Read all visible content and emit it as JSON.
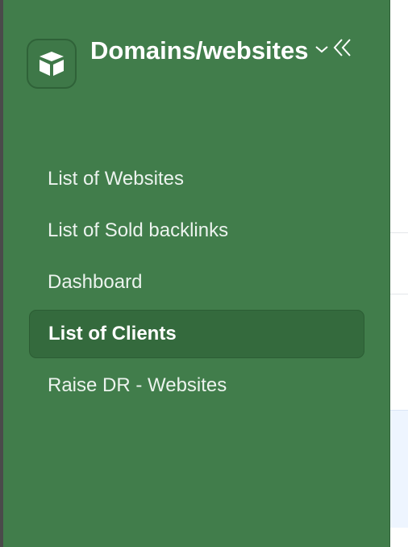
{
  "sidebar": {
    "app_title": "Domains/websites",
    "items": [
      {
        "label": "List of Websites",
        "active": false
      },
      {
        "label": "List of Sold backlinks",
        "active": false
      },
      {
        "label": "Dashboard",
        "active": false
      },
      {
        "label": "List of Clients",
        "active": true
      },
      {
        "label": "Raise DR - Websites",
        "active": false
      }
    ]
  },
  "icons": {
    "logo": "cube-logo-icon",
    "dropdown": "chevron-down-icon",
    "collapse": "double-chevron-left-icon"
  },
  "colors": {
    "sidebar_bg": "#417d4b",
    "active_bg": "#346a3d",
    "text": "#ffffff"
  }
}
